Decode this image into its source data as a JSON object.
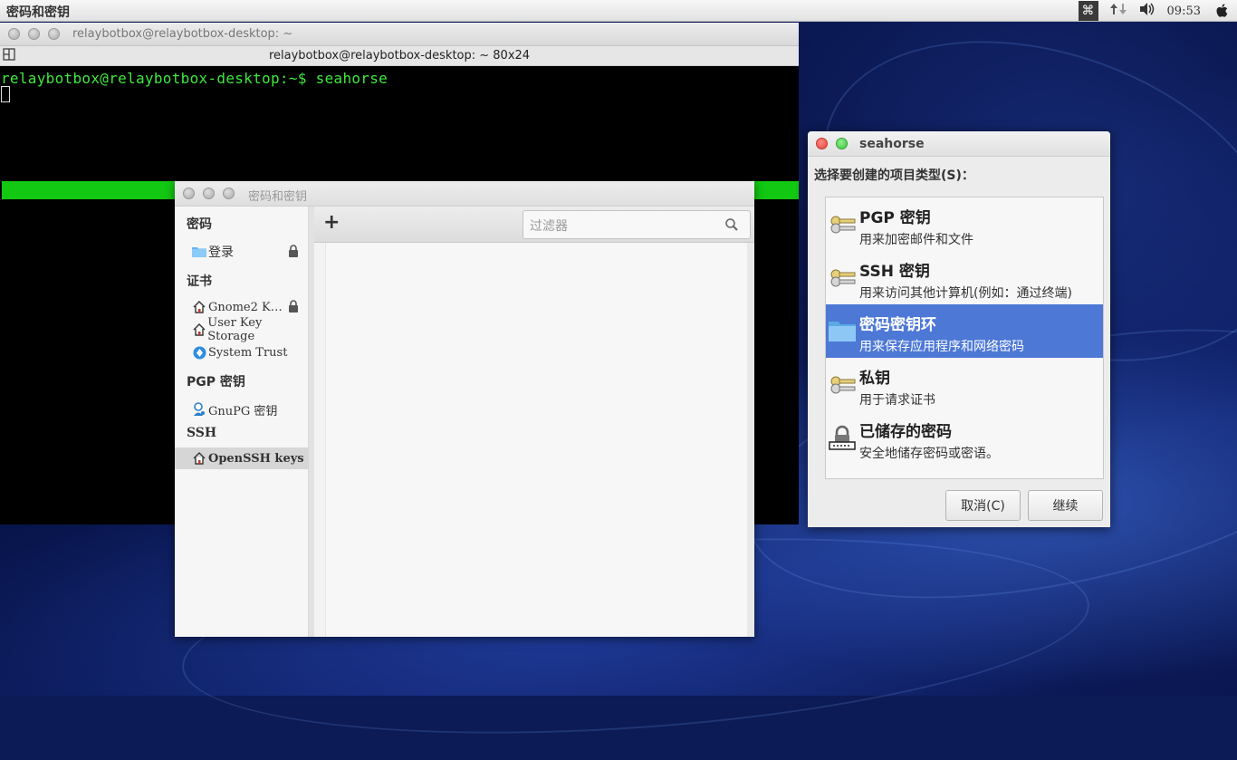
{
  "top_panel": {
    "app_title": "密码和密钥",
    "clock": "09:53"
  },
  "terminal": {
    "window_title": "relaybotbox@relaybotbox-desktop: ~",
    "tab_title": "relaybotbox@relaybotbox-desktop: ~ 80x24",
    "prompt_line": "relaybotbox@relaybotbox-desktop:~$ seahorse",
    "bar_color": "#12c812"
  },
  "keys_window": {
    "title": "密码和密钥",
    "filter_placeholder": "过滤器",
    "sidebar": {
      "passwords_header": "密码",
      "login": "登录",
      "certs_header": "证书",
      "gnome2": "Gnome2 K…",
      "user_key_storage": "User Key Storage",
      "system_trust": "System Trust",
      "pgp_header": "PGP 密钥",
      "gnupg": "GnuPG 密钥",
      "ssh_header": "SSH",
      "openssh": "OpenSSH keys"
    }
  },
  "dialog": {
    "title": "seahorse",
    "prompt": "选择要创建的项目类型(S)：",
    "items": [
      {
        "name": "PGP 密钥",
        "desc": "用来加密邮件和文件",
        "icon": "keys-icon"
      },
      {
        "name": "SSH 密钥",
        "desc": "用来访问其他计算机(例如：通过终端)",
        "icon": "keys-icon"
      },
      {
        "name": "密码密钥环",
        "desc": "用来保存应用程序和网络密码",
        "icon": "folder-icon"
      },
      {
        "name": "私钥",
        "desc": "用于请求证书",
        "icon": "keys-icon"
      },
      {
        "name": "已储存的密码",
        "desc": "安全地储存密码或密语。",
        "icon": "password-lock-icon"
      }
    ],
    "selected_index": 2,
    "cancel_label": "取消(C)",
    "continue_label": "继续",
    "selection_color": "#4d78d6"
  }
}
